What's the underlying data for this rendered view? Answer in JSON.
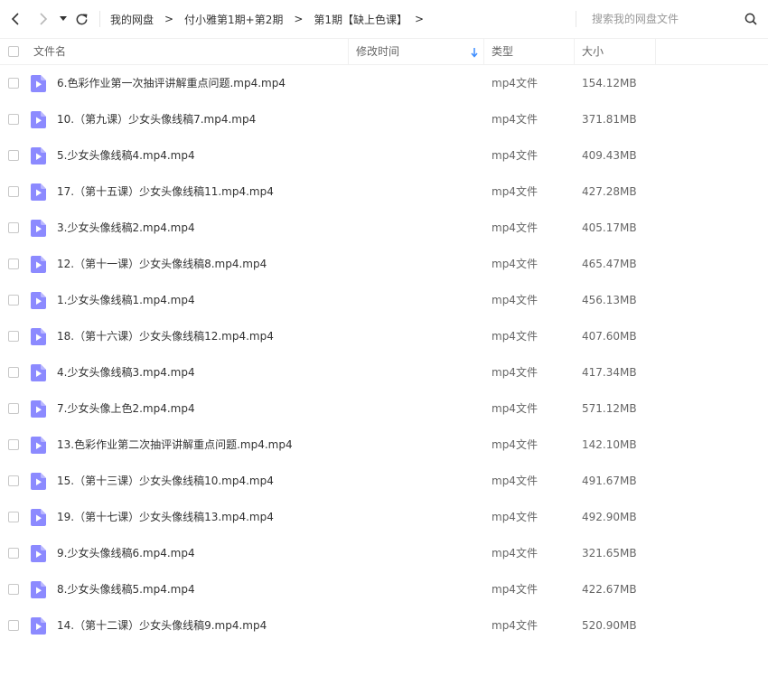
{
  "colors": {
    "icon_purple": "#8c8aff",
    "sort_arrow_blue": "#3b8cff"
  },
  "navigation": {
    "back_icon": "chevron-left-icon",
    "forward_icon": "chevron-right-icon",
    "dropdown_icon": "caret-down-icon",
    "refresh_icon": "refresh-icon"
  },
  "breadcrumb": {
    "items": [
      "我的网盘",
      "付小雅第1期+第2期",
      "第1期【缺上色课】"
    ],
    "separator": ">"
  },
  "search": {
    "placeholder": "搜索我的网盘文件",
    "value": "",
    "icon": "search-icon"
  },
  "columns": {
    "name": "文件名",
    "modified": "修改时间",
    "type": "类型",
    "size": "大小",
    "sort_icon": "sort-down-arrow-icon"
  },
  "files": [
    {
      "name": "6.色彩作业第一次抽评讲解重点问题.mp4.mp4",
      "type": "mp4文件",
      "size": "154.12MB",
      "icon": "video-file-icon"
    },
    {
      "name": "10.（第九课）少女头像线稿7.mp4.mp4",
      "type": "mp4文件",
      "size": "371.81MB",
      "icon": "video-file-icon"
    },
    {
      "name": "5.少女头像线稿4.mp4.mp4",
      "type": "mp4文件",
      "size": "409.43MB",
      "icon": "video-file-icon"
    },
    {
      "name": "17.（第十五课）少女头像线稿11.mp4.mp4",
      "type": "mp4文件",
      "size": "427.28MB",
      "icon": "video-file-icon"
    },
    {
      "name": "3.少女头像线稿2.mp4.mp4",
      "type": "mp4文件",
      "size": "405.17MB",
      "icon": "video-file-icon"
    },
    {
      "name": "12.（第十一课）少女头像线稿8.mp4.mp4",
      "type": "mp4文件",
      "size": "465.47MB",
      "icon": "video-file-icon"
    },
    {
      "name": "1.少女头像线稿1.mp4.mp4",
      "type": "mp4文件",
      "size": "456.13MB",
      "icon": "video-file-icon"
    },
    {
      "name": "18.（第十六课）少女头像线稿12.mp4.mp4",
      "type": "mp4文件",
      "size": "407.60MB",
      "icon": "video-file-icon"
    },
    {
      "name": "4.少女头像线稿3.mp4.mp4",
      "type": "mp4文件",
      "size": "417.34MB",
      "icon": "video-file-icon"
    },
    {
      "name": "7.少女头像上色2.mp4.mp4",
      "type": "mp4文件",
      "size": "571.12MB",
      "icon": "video-file-icon"
    },
    {
      "name": "13.色彩作业第二次抽评讲解重点问题.mp4.mp4",
      "type": "mp4文件",
      "size": "142.10MB",
      "icon": "video-file-icon"
    },
    {
      "name": "15.（第十三课）少女头像线稿10.mp4.mp4",
      "type": "mp4文件",
      "size": "491.67MB",
      "icon": "video-file-icon"
    },
    {
      "name": "19.（第十七课）少女头像线稿13.mp4.mp4",
      "type": "mp4文件",
      "size": "492.90MB",
      "icon": "video-file-icon"
    },
    {
      "name": "9.少女头像线稿6.mp4.mp4",
      "type": "mp4文件",
      "size": "321.65MB",
      "icon": "video-file-icon"
    },
    {
      "name": "8.少女头像线稿5.mp4.mp4",
      "type": "mp4文件",
      "size": "422.67MB",
      "icon": "video-file-icon"
    },
    {
      "name": "14.（第十二课）少女头像线稿9.mp4.mp4",
      "type": "mp4文件",
      "size": "520.90MB",
      "icon": "video-file-icon"
    }
  ]
}
